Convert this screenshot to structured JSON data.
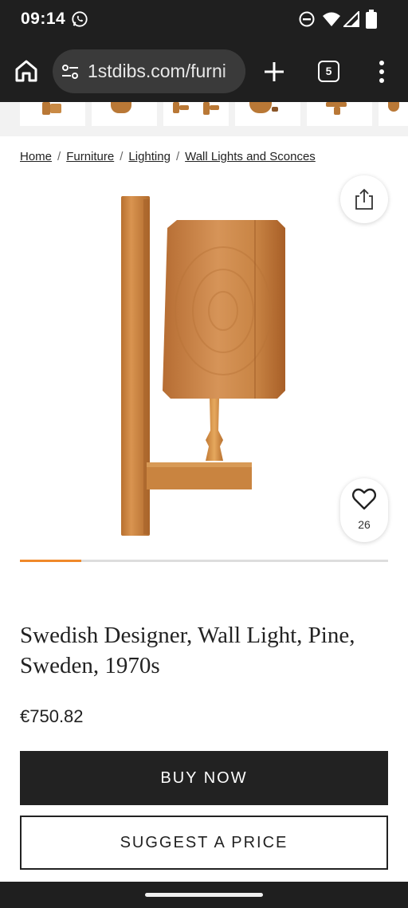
{
  "status_bar": {
    "time": "09:14",
    "icons": [
      "whatsapp-icon",
      "do-not-disturb-icon",
      "wifi-icon",
      "signal-icon",
      "battery-icon"
    ]
  },
  "browser": {
    "url": "1stdibs.com/furni",
    "tab_count": "5",
    "icons": [
      "home-icon",
      "site-settings-icon",
      "plus-icon",
      "tab-switcher-icon",
      "more-vert-icon"
    ]
  },
  "breadcrumb": {
    "items": [
      "Home",
      "Furniture",
      "Lighting",
      "Wall Lights and Sconces"
    ],
    "separator": "/"
  },
  "gallery": {
    "favorite_count": "26",
    "progress_fraction": 0.166,
    "accent_color": "#f0892a"
  },
  "product": {
    "title": "Swedish Designer, Wall Light, Pine, Sweden, 1970s",
    "price": "€750.82"
  },
  "actions": {
    "buy_now": "BUY NOW",
    "suggest_price": "SUGGEST A PRICE"
  },
  "colors": {
    "dark": "#1f1f1f",
    "button": "#222222",
    "wood": "#c8803f"
  }
}
